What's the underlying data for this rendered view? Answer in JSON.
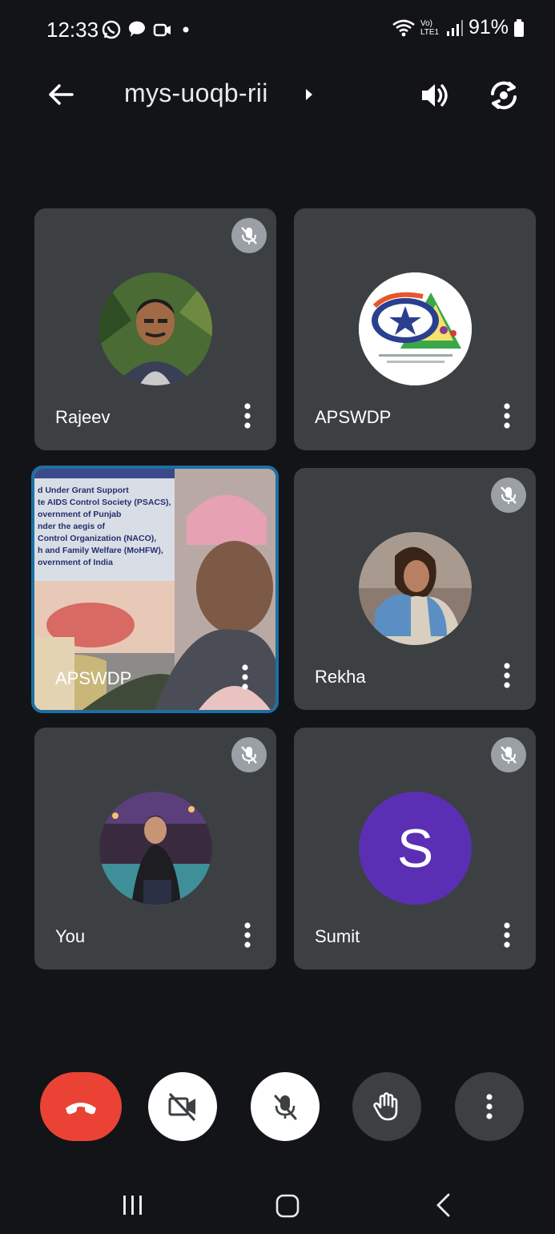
{
  "status": {
    "time": "12:33",
    "network": "Vo) LTE1",
    "battery": "91%"
  },
  "header": {
    "meeting_code": "mys-uoqb-rii"
  },
  "tiles": [
    {
      "name": "Rajeev",
      "muted": true
    },
    {
      "name": "APSWDP",
      "muted": false
    },
    {
      "name": "APSWDP",
      "muted": false,
      "video": true,
      "banner_lines": [
        "d Under Grant Support",
        "te AIDS Control Society (PSACS),",
        "overnment of Punjab",
        "nder the aegis of",
        "Control Organization (NACO),",
        "h and Family Welfare (MoHFW),",
        "overnment of India"
      ]
    },
    {
      "name": "Rekha",
      "muted": true
    },
    {
      "name": "You",
      "muted": true
    },
    {
      "name": "Sumit",
      "muted": true,
      "initial": "S"
    }
  ],
  "colors": {
    "background": "#131417",
    "tile": "#3c4043",
    "end_call": "#ea4335",
    "avatar_sumit": "#5b2fb3",
    "active_border": "#1d6fa3"
  },
  "icons": {
    "back": "arrow-left-icon",
    "speaker": "speaker-icon",
    "switch_camera": "switch-camera-icon",
    "mute": "mic-off-icon",
    "menu": "more-vert-icon",
    "end_call": "phone-hangup-icon",
    "camera_off": "video-off-icon",
    "hand": "hand-raise-icon"
  }
}
